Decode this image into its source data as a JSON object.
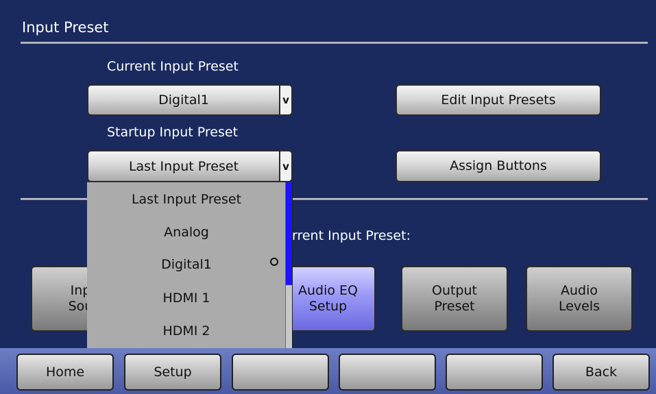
{
  "header": {
    "title": "Input Preset"
  },
  "current_preset": {
    "label": "Current Input Preset",
    "value": "Digital1",
    "chevron": "v"
  },
  "startup_preset": {
    "label": "Startup Input Preset",
    "value": "Last Input Preset",
    "chevron": "v"
  },
  "buttons": {
    "edit": "Edit Input Presets",
    "assign": "Assign Buttons"
  },
  "section2_label_visible": "rrent Input Preset:",
  "tiles": [
    {
      "line1": "Inp",
      "line2": "Sou"
    },
    {
      "line1": "Audio EQ",
      "line2": "Setup"
    },
    {
      "line1": "Output",
      "line2": "Preset"
    },
    {
      "line1": "Audio",
      "line2": "Levels"
    }
  ],
  "dropdown_options": [
    "Last Input Preset",
    "Analog",
    "Digital1",
    "HDMI 1",
    "HDMI 2"
  ],
  "scroll_position": 0.0,
  "navbar": {
    "home": "Home",
    "setup": "Setup",
    "back": "Back",
    "blank1": "",
    "blank2": "",
    "blank3": ""
  },
  "colors": {
    "background": "#1a2a5e",
    "selected_tile": "#9a98f6",
    "scroll_thumb": "#1a14ff",
    "navbar": "#5b6bb5"
  }
}
